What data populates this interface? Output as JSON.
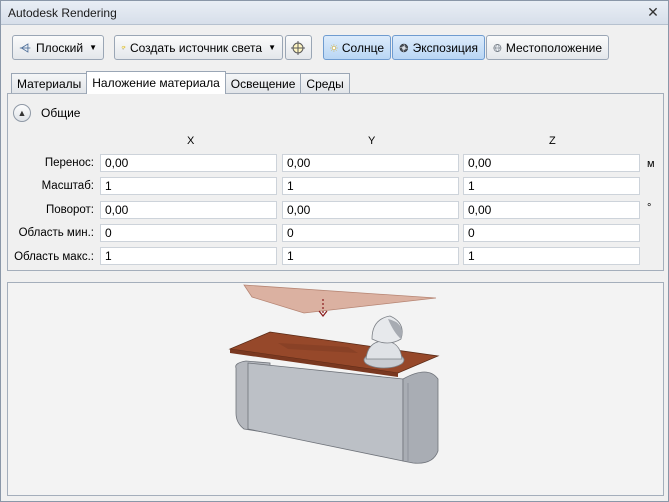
{
  "window": {
    "title": "Autodesk Rendering",
    "close_glyph": "✕"
  },
  "toolbar": {
    "projection_label": "Плоский",
    "create_light_label": "Создать источник света",
    "sun_label": "Солнце",
    "exposure_label": "Экспозиция",
    "location_label": "Местоположение"
  },
  "tabs": [
    {
      "label": "Материалы"
    },
    {
      "label": "Наложение материала"
    },
    {
      "label": "Освещение"
    },
    {
      "label": "Среды"
    }
  ],
  "group": {
    "title": "Общие"
  },
  "columns": {
    "x": "X",
    "y": "Y",
    "z": "Z"
  },
  "rows": [
    {
      "label": "Перенос:",
      "x": "0,00",
      "y": "0,00",
      "z": "0,00",
      "unit": "м"
    },
    {
      "label": "Масштаб:",
      "x": "1",
      "y": "1",
      "z": "1",
      "unit": ""
    },
    {
      "label": "Поворот:",
      "x": "0,00",
      "y": "0,00",
      "z": "0,00",
      "unit": "°"
    },
    {
      "label": "Область мин.:",
      "x": "0",
      "y": "0",
      "z": "0",
      "unit": ""
    },
    {
      "label": "Область макс.:",
      "x": "1",
      "y": "1",
      "z": "1",
      "unit": ""
    }
  ],
  "colors": {
    "plane_top": "#d7a898",
    "plane_material": "#9a4a2c",
    "object_body": "#b6b9bf",
    "probe_arrow": "#8a1a1a"
  }
}
